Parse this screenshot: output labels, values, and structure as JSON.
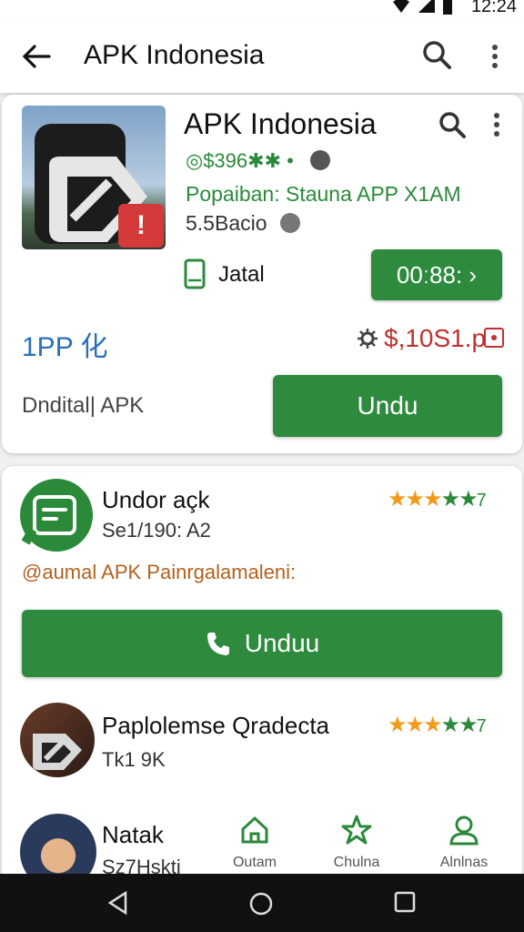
{
  "status_bar": {
    "time": "12:24"
  },
  "app_bar": {
    "title": "APK Indonesia"
  },
  "featured": {
    "title": "APK Indonesia",
    "meta": "◎$396✱✱ •",
    "developer": "Popaiban: Stauna APP X1AM",
    "size": "5.5Bacio",
    "install_label": "Jatal",
    "small_button": "00ː88: ›",
    "left_tag": "1PP 化",
    "price": "$,10S1.p",
    "footer_label": "Dndital| APK",
    "download_button": "Undu",
    "badge": "!"
  },
  "list": [
    {
      "title": "Undor açk",
      "subtitle": "Se1/190: A2",
      "rating": "7"
    },
    {
      "title": "Paplolemse Qradecta",
      "subtitle": "Tk1 9K",
      "rating": "7"
    },
    {
      "title": "Natak",
      "subtitle": "Sz7Hskti"
    }
  ],
  "list_desc": "@aumal APK Painrgalamaleni:",
  "list_download_button": "Unduu",
  "bottom_nav": [
    {
      "label": "Outam",
      "icon": "home-icon"
    },
    {
      "label": "Chulna",
      "icon": "star-icon"
    },
    {
      "label": "Alnlnas",
      "icon": "person-icon"
    }
  ],
  "colors": {
    "accent": "#2e8b3e",
    "price": "#c0302e",
    "link": "#2a6fb8"
  }
}
